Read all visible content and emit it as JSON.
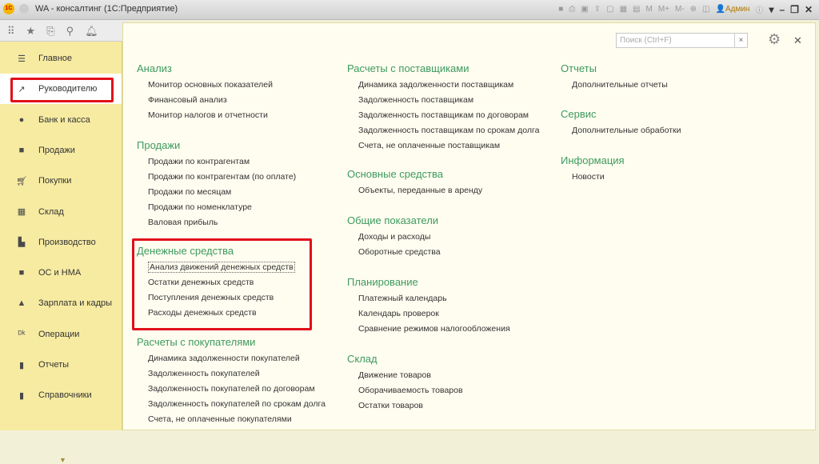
{
  "window": {
    "title": "WA - консалтинг  (1С:Предприятие)",
    "user": "Админ",
    "tools": [
      "M",
      "M+",
      "M-"
    ]
  },
  "sidebar": {
    "items": [
      {
        "label": "Главное",
        "icon": "menu-icon"
      },
      {
        "label": "Руководителю",
        "icon": "trend-icon"
      },
      {
        "label": "Банк и касса",
        "icon": "ruble-icon"
      },
      {
        "label": "Продажи",
        "icon": "bag-icon"
      },
      {
        "label": "Покупки",
        "icon": "cart-icon"
      },
      {
        "label": "Склад",
        "icon": "grid-icon"
      },
      {
        "label": "Производство",
        "icon": "factory-icon"
      },
      {
        "label": "ОС и НМА",
        "icon": "truck-icon"
      },
      {
        "label": "Зарплата и кадры",
        "icon": "person-icon"
      },
      {
        "label": "Операции",
        "icon": "dt-kt-icon"
      },
      {
        "label": "Отчеты",
        "icon": "bar-chart-icon"
      },
      {
        "label": "Справочники",
        "icon": "book-icon"
      }
    ]
  },
  "search": {
    "placeholder": "Поиск (Ctrl+F)"
  },
  "groups": [
    {
      "title": "Анализ",
      "items": [
        "Монитор основных показателей",
        "Финансовый анализ",
        "Монитор налогов и отчетности"
      ]
    },
    {
      "title": "Продажи",
      "items": [
        "Продажи по контрагентам",
        "Продажи по контрагентам (по оплате)",
        "Продажи по месяцам",
        "Продажи по номенклатуре",
        "Валовая прибыль"
      ]
    },
    {
      "title": "Денежные средства",
      "items": [
        "Анализ движений денежных средств",
        "Остатки денежных средств",
        "Поступления денежных средств",
        "Расходы денежных средств"
      ]
    },
    {
      "title": "Расчеты с покупателями",
      "items": [
        "Динамика задолженности покупателей",
        "Задолженность покупателей",
        "Задолженность покупателей по договорам",
        "Задолженность покупателей по срокам долга",
        "Счета, не оплаченные покупателями"
      ]
    },
    {
      "title": "Расчеты с поставщиками",
      "items": [
        "Динамика задолженности поставщикам",
        "Задолженность поставщикам",
        "Задолженность поставщикам по договорам",
        "Задолженность поставщикам по срокам долга",
        "Счета, не оплаченные поставщикам"
      ]
    },
    {
      "title": "Основные средства",
      "items": [
        "Объекты, переданные в аренду"
      ]
    },
    {
      "title": "Общие показатели",
      "items": [
        "Доходы и расходы",
        "Оборотные средства"
      ]
    },
    {
      "title": "Планирование",
      "items": [
        "Платежный календарь",
        "Календарь проверок",
        "Сравнение режимов налогообложения"
      ]
    },
    {
      "title": "Склад",
      "items": [
        "Движение товаров",
        "Оборачиваемость товаров",
        "Остатки товаров"
      ]
    },
    {
      "title": "Отчеты",
      "items": [
        "Дополнительные отчеты"
      ]
    },
    {
      "title": "Сервис",
      "items": [
        "Дополнительные обработки"
      ]
    },
    {
      "title": "Информация",
      "items": [
        "Новости"
      ]
    }
  ]
}
